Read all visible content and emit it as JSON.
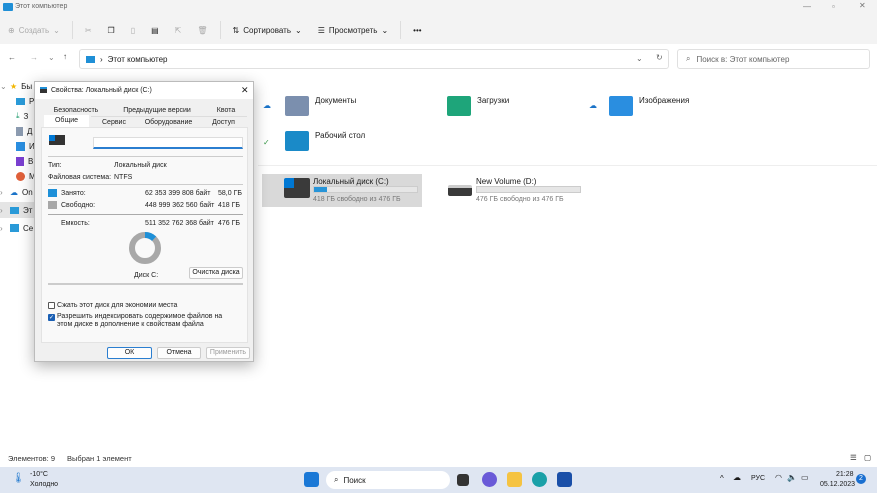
{
  "window": {
    "title": "Этот компьютер"
  },
  "toolbar": {
    "create": "Создать",
    "sort": "Сортировать",
    "view": "Просмотреть",
    "more": "•••"
  },
  "nav": {
    "path": "Этот компьютер",
    "search_placeholder": "Поиск в: Этот компьютер"
  },
  "sidebar": {
    "items": [
      {
        "label": "Бы"
      },
      {
        "label": "Р"
      },
      {
        "label": "З"
      },
      {
        "label": "Д"
      },
      {
        "label": "И"
      },
      {
        "label": "В"
      },
      {
        "label": "М"
      },
      {
        "label": "On"
      },
      {
        "label": "Эт"
      },
      {
        "label": "Се"
      }
    ]
  },
  "folders": [
    {
      "label": "Документы"
    },
    {
      "label": "Загрузки"
    },
    {
      "label": "Изображения"
    },
    {
      "label": "Рабочий стол"
    }
  ],
  "drives": [
    {
      "label": "Локальный диск (C:)",
      "info": "418 ГБ свободно из 476 ГБ",
      "used_fraction": 0.122
    },
    {
      "label": "New Volume (D:)",
      "info": "476 ГБ свободно из 476 ГБ",
      "used_fraction": 0.0
    }
  ],
  "status": {
    "count": "Элементов: 9",
    "selected": "Выбран 1 элемент"
  },
  "dialog": {
    "title": "Свойства: Локальный диск (C:)",
    "tabs_back": [
      "Безопасность",
      "Предыдущие версии",
      "Квота"
    ],
    "tabs_front": [
      "Общие",
      "Сервис",
      "Оборудование",
      "Доступ"
    ],
    "name_value": "",
    "type_label": "Тип:",
    "type_value": "Локальный диск",
    "fs_label": "Файловая система:",
    "fs_value": "NTFS",
    "used_label": "Занято:",
    "used_bytes": "62 353 399 808 байт",
    "used_gb": "58,0 ГБ",
    "free_label": "Свободно:",
    "free_bytes": "448 999 362 560 байт",
    "free_gb": "418 ГБ",
    "cap_label": "Емкость:",
    "cap_bytes": "511 352 762 368 байт",
    "cap_gb": "476 ГБ",
    "used_fraction": 0.122,
    "disk_label": "Диск C:",
    "cleanup": "Очистка диска",
    "compress": "Сжать этот диск для экономии места",
    "compress_checked": false,
    "index": "Разрешить индексировать содержимое файлов на этом диске в дополнение к свойствам файла",
    "index_checked": true,
    "ok": "ОК",
    "cancel": "Отмена",
    "apply": "Применить",
    "colors": {
      "used": "#1e90d8",
      "free": "#a8a8a8"
    }
  },
  "taskbar": {
    "temp": "-10°C",
    "weather": "Холодно",
    "search": "Поиск",
    "lang": "РУС",
    "time": "21:28",
    "date": "05.12.2023",
    "badge": "2"
  }
}
